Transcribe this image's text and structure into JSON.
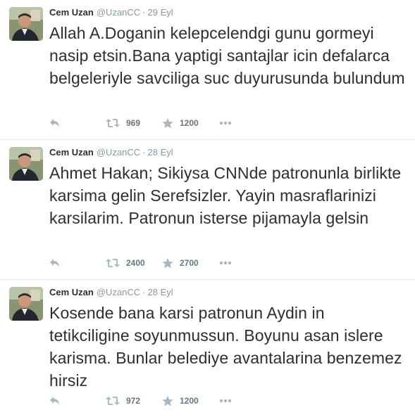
{
  "tweets": [
    {
      "fullname": "Cem Uzan",
      "username": "@UzanCC",
      "separator": "·",
      "time": "29 Eyl",
      "text": "Allah A.Doganin kelepcelendgi gunu gormeyi nasip etsin.Bana yaptigi santajlar icin defalarca belgeleriyle savciliga suc duyurusunda bulundum",
      "retweets": "969",
      "favorites": "1200"
    },
    {
      "fullname": "Cem Uzan",
      "username": "@UzanCC",
      "separator": "·",
      "time": "28 Eyl",
      "text": "Ahmet Hakan; Sikiysa CNNde patronunla birlikte karsima gelin Serefsizler. Yayin masraflarinizi karsilarim. Patronun isterse pijamayla gelsin",
      "retweets": "2400",
      "favorites": "2700"
    },
    {
      "fullname": "Cem Uzan",
      "username": "@UzanCC",
      "separator": "·",
      "time": "28 Eyl",
      "text": "Kosende bana karsi patronun Aydin in tetikciligine soyunmussun. Boyunu asan islere karisma.  Bunlar belediye avantalarina benzemez hirsiz",
      "retweets": "972",
      "favorites": "1200"
    }
  ],
  "icons": {
    "reply": "reply-icon",
    "retweet": "retweet-icon",
    "favorite": "star-icon",
    "more": "more-dots-icon"
  },
  "colors": {
    "text": "#292f33",
    "muted": "#8899a6",
    "icon": "#aab8c2",
    "count": "#66757f",
    "divider": "#e1e8ed"
  }
}
